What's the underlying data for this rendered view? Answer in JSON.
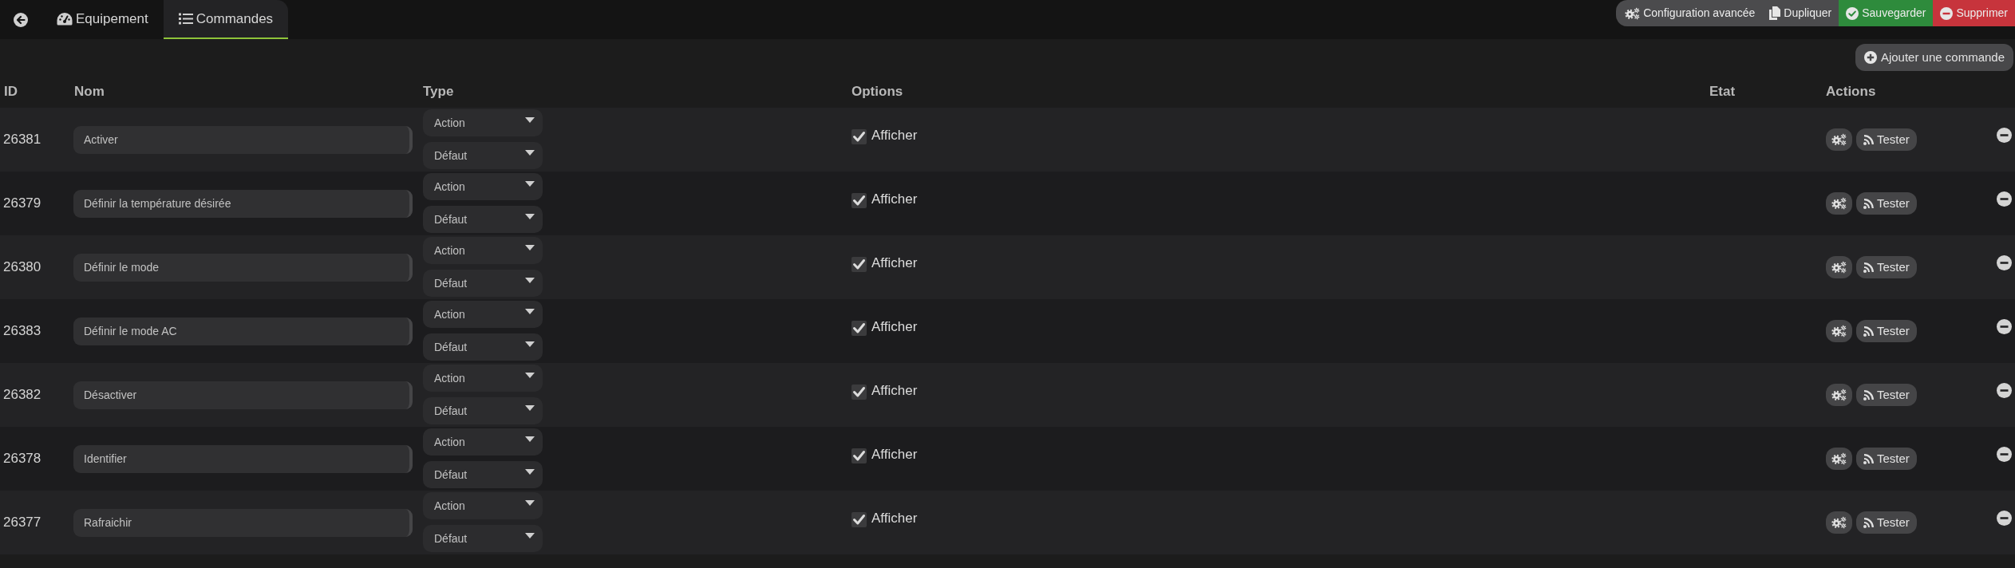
{
  "tabs": [
    {
      "label": "Equipement",
      "selected": false
    },
    {
      "label": "Commandes",
      "selected": true
    }
  ],
  "actions": [
    {
      "kind": "config",
      "label": "Configuration avancée"
    },
    {
      "kind": "duplicate",
      "label": "Dupliquer"
    },
    {
      "kind": "save",
      "label": "Sauvegarder"
    },
    {
      "kind": "delete",
      "label": "Supprimer"
    }
  ],
  "add_button": {
    "label": "Ajouter une commande"
  },
  "table": {
    "columns": [
      "ID",
      "Nom",
      "Type",
      "Options",
      "Etat",
      "Actions"
    ],
    "rows": [
      {
        "id": "26381",
        "name": "Activer",
        "type": "Action",
        "subtype": "Défaut",
        "display": {
          "label": "Afficher",
          "checked": true
        },
        "test_button": "Tester"
      },
      {
        "id": "26379",
        "name": "Définir la température désirée",
        "type": "Action",
        "subtype": "Défaut",
        "display": {
          "label": "Afficher",
          "checked": true
        },
        "test_button": "Tester"
      },
      {
        "id": "26380",
        "name": "Définir le mode",
        "type": "Action",
        "subtype": "Défaut",
        "display": {
          "label": "Afficher",
          "checked": true
        },
        "test_button": "Tester"
      },
      {
        "id": "26383",
        "name": "Définir le mode AC",
        "type": "Action",
        "subtype": "Défaut",
        "display": {
          "label": "Afficher",
          "checked": true
        },
        "test_button": "Tester"
      },
      {
        "id": "26382",
        "name": "Désactiver",
        "type": "Action",
        "subtype": "Défaut",
        "display": {
          "label": "Afficher",
          "checked": true
        },
        "test_button": "Tester"
      },
      {
        "id": "26378",
        "name": "Identifier",
        "type": "Action",
        "subtype": "Défaut",
        "display": {
          "label": "Afficher",
          "checked": true
        },
        "test_button": "Tester"
      },
      {
        "id": "26377",
        "name": "Rafraichir",
        "type": "Action",
        "subtype": "Défaut",
        "display": {
          "label": "Afficher",
          "checked": true
        },
        "test_button": "Tester"
      }
    ]
  }
}
